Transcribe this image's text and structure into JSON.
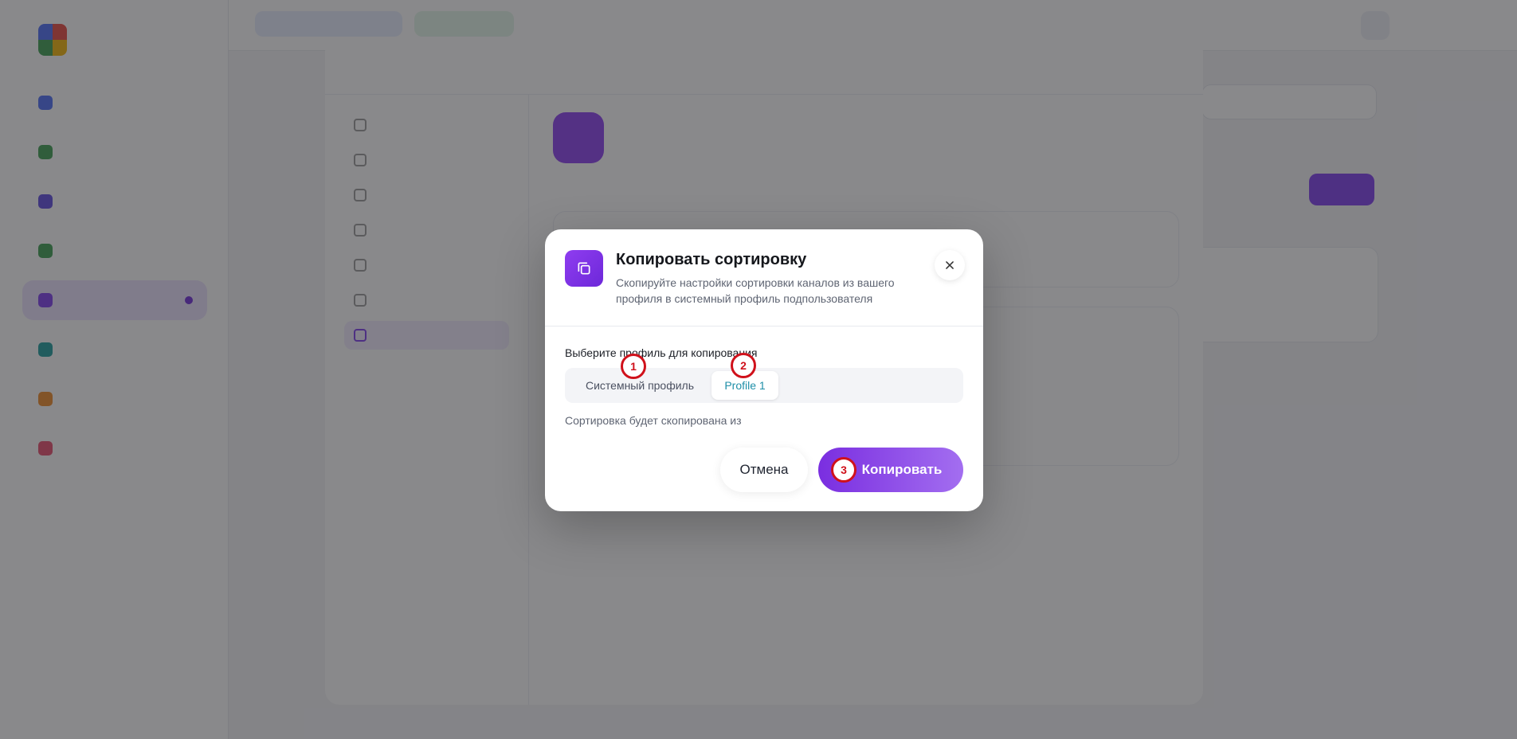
{
  "dialog": {
    "title": "Копировать сортировку",
    "description": "Скопируйте настройки сортировки каналов из вашего профиля в системный профиль подпользователя",
    "select_label": "Выберите профиль для копирования",
    "tabs": [
      {
        "label": "Системный профиль",
        "selected": false
      },
      {
        "label": "Profile 1",
        "selected": true
      }
    ],
    "note": "Сортировка будет скопирована из",
    "cancel_label": "Отмена",
    "copy_label": "Копировать",
    "icon": "copy-icon",
    "close_icon": "close-icon"
  },
  "markers": [
    "1",
    "2",
    "3"
  ],
  "colors": {
    "accent": "#7c3aed",
    "marker": "#d0111b",
    "selected_tab_text": "#1f8fa8"
  }
}
